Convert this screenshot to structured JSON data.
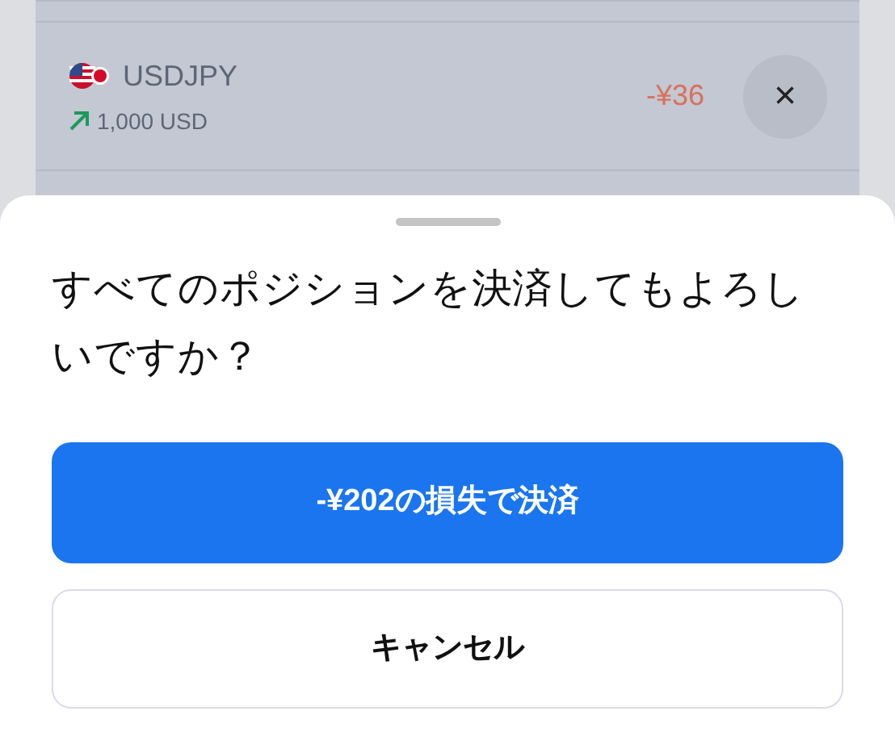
{
  "position": {
    "symbol": "USDJPY",
    "rising": true,
    "amount": "1,000 USD",
    "pnl": "-¥36",
    "close_button": "×"
  },
  "sheet": {
    "title": "すべてのポジションを決済してもよろしいですか？",
    "buttons": [
      {
        "label": "-¥202の損失で決済",
        "kind": "primary"
      },
      {
        "label": "キャンセル",
        "kind": "secondary"
      }
    ]
  }
}
